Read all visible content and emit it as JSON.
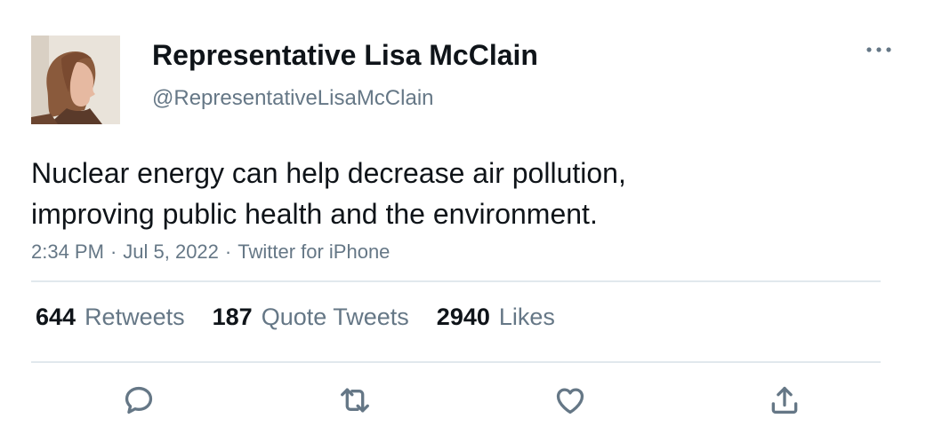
{
  "author": {
    "display_name": "Representative Lisa McClain",
    "handle": "@RepresentativeLisaMcClain",
    "avatar_icon": "profile-photo"
  },
  "tweet": {
    "text_lines": [
      "Nuclear energy can help decrease air pollution,",
      "improving public health and the environment."
    ],
    "time": "2:34 PM",
    "date": "Jul 5, 2022",
    "source": "Twitter for iPhone",
    "separator": "·"
  },
  "stats": {
    "retweets": {
      "count": "644",
      "label": "Retweets"
    },
    "quote_tweets": {
      "count": "187",
      "label": "Quote Tweets"
    },
    "likes": {
      "count": "2940",
      "label": "Likes"
    }
  },
  "icons": {
    "more": "more-horizontal-icon",
    "reply": "reply-icon",
    "retweet": "retweet-icon",
    "like": "heart-icon",
    "share": "share-icon"
  },
  "colors": {
    "text_primary": "#0f1419",
    "text_secondary": "#657786",
    "divider": "#e1e8ed"
  }
}
